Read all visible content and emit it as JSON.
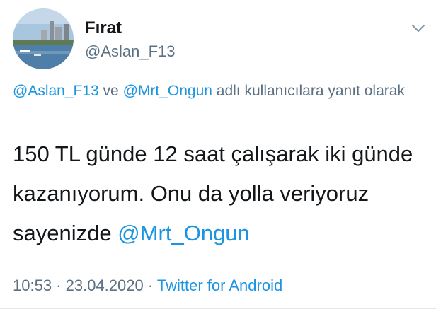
{
  "user": {
    "display_name": "Fırat",
    "handle": "@Aslan_F13",
    "avatar": "avatar-icon"
  },
  "reply_context": {
    "mention_1": "@Aslan_F13",
    "connector": " ve ",
    "mention_2": "@Mrt_Ongun",
    "suffix": " adlı kullanıcılara yanıt olarak"
  },
  "tweet": {
    "text": "150 TL günde 12 saat çalışarak iki günde kazanıyorum. Onu da yolla veriyoruz sayenizde ",
    "mention": "@Mrt_Ongun"
  },
  "meta": {
    "time": "10:53",
    "separator_1": " · ",
    "date": "23.04.2020",
    "separator_2": " · ",
    "source": "Twitter for Android"
  },
  "icons": {
    "menu": "chevron-down-icon"
  },
  "colors": {
    "link": "#1b95e0",
    "secondary": "#5b7083",
    "primary": "#14171a"
  }
}
